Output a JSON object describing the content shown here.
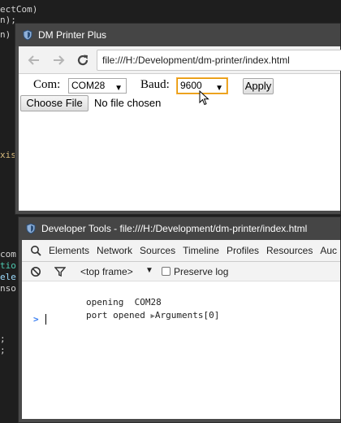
{
  "editor": {
    "lines": [
      {
        "text": "ectCom)",
        "color": "#d4d4d4"
      },
      {
        "text": "n);",
        "color": "#d4d4d4"
      },
      {
        "text": "n)",
        "color": "#d4d4d4"
      },
      {
        "text": "xis",
        "color": "#d7ba7d"
      },
      {
        "text": "com",
        "color": "#d4d4d4"
      },
      {
        "text": "tio",
        "color": "#4ec9b0"
      },
      {
        "text": "ele",
        "color": "#9cdcfe"
      },
      {
        "text": "nso",
        "color": "#d4d4d4"
      },
      {
        "text": ";",
        "color": "#d4d4d4"
      },
      {
        "text": ";",
        "color": "#d4d4d4"
      }
    ]
  },
  "browser_window": {
    "title": "DM Printer Plus",
    "address": "file:///H:/Development/dm-printer/index.html",
    "form": {
      "com_label": "Com:",
      "com_value": "COM28",
      "baud_label": "Baud:",
      "baud_value": "9600",
      "apply_label": "Apply",
      "choose_file_label": "Choose File",
      "no_file_text": "No file chosen"
    }
  },
  "devtools_window": {
    "title": "Developer Tools - file:///H:/Development/dm-printer/index.html",
    "tabs": [
      "Elements",
      "Network",
      "Sources",
      "Timeline",
      "Profiles",
      "Resources",
      "Auc"
    ],
    "frame_selector": "<top frame>",
    "preserve_log_label": "Preserve log",
    "console": {
      "line1_label": "opening",
      "line1_value": "COM28",
      "line2_label": "port opened",
      "line2_object": "Arguments[0]",
      "prompt": ">"
    }
  },
  "colors": {
    "window_frame": "#4a4a4a",
    "focus_ring": "#e59700",
    "prompt_blue": "#367cf1"
  }
}
